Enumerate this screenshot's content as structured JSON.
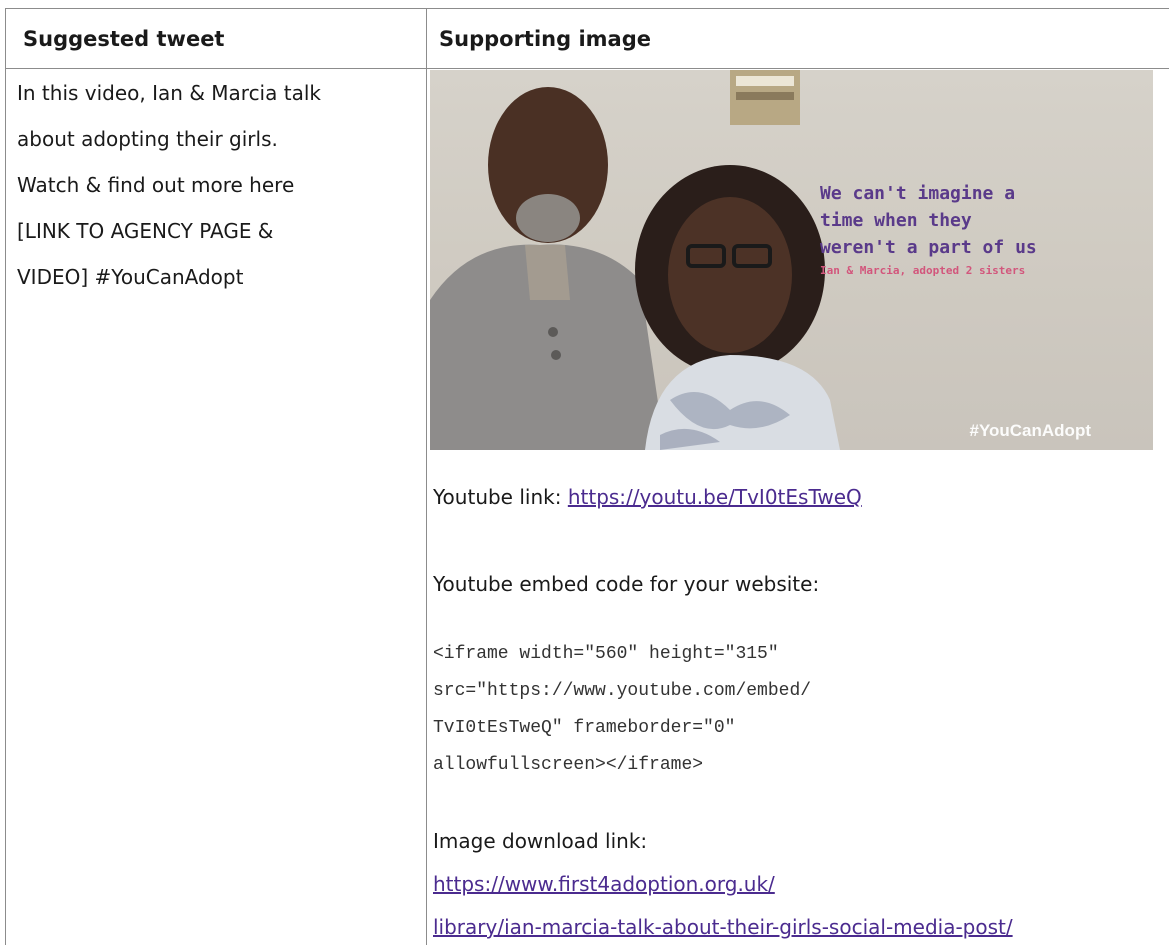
{
  "table": {
    "headers": [
      "Suggested tweet",
      "Supporting image"
    ]
  },
  "tweet": {
    "lines": [
      "In this video, Ian & Marcia talk",
      "about adopting their girls.",
      "Watch & find out more here",
      "[LINK TO AGENCY PAGE &",
      "VIDEO] #YouCanAdopt"
    ]
  },
  "image": {
    "quote_lines": [
      "We can't imagine a",
      "time when they",
      "weren't a part of us"
    ],
    "quote_sub": "Ian & Marcia, adopted 2 sisters",
    "hashtag": "#YouCanAdopt",
    "colors": {
      "quote": "#5a3a8a",
      "quote_sub": "#d2567c"
    }
  },
  "links": {
    "youtube_label": "Youtube link: ",
    "youtube_url": "https://youtu.be/TvI0tEsTweQ",
    "embed_label": "Youtube embed code for your website:",
    "embed_code_lines": [
      "<iframe width=\"560\" height=\"315\"",
      "src=\"https://www.youtube.com/embed/",
      "TvI0tEsTweQ\" frameborder=\"0\"",
      "allowfullscreen></iframe>"
    ],
    "image_label": "Image download link: ",
    "image_url_lines": [
      "https://www.first4adoption.org.uk/",
      "library/ian-marcia-talk-about-their-girls-social-media-post/"
    ],
    "link_color": "#4b2b8f"
  }
}
